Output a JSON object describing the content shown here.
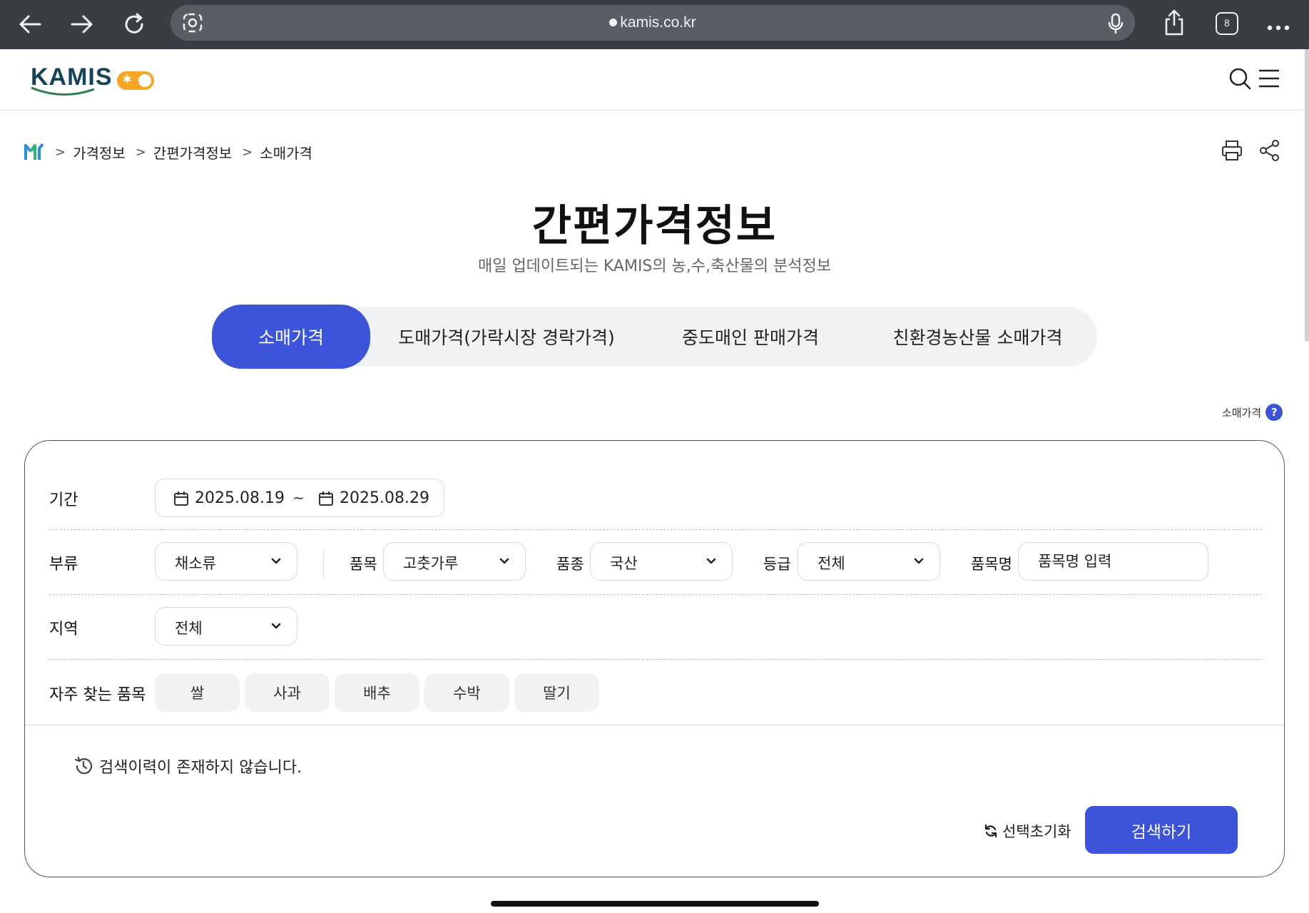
{
  "browser": {
    "url": "kamis.co.kr",
    "tab_count": "8"
  },
  "site": {
    "logo_text": "KAMIS"
  },
  "breadcrumb": {
    "items": [
      "가격정보",
      "간편가격정보",
      "소매가격"
    ],
    "separator": ">"
  },
  "page": {
    "title": "간편가격정보",
    "subtitle": "매일 업데이트되는 KAMIS의 농,수,축산물의 분석정보"
  },
  "tabs": [
    {
      "label": "소매가격",
      "active": true
    },
    {
      "label": "도매가격(가락시장 경락가격)",
      "active": false
    },
    {
      "label": "중도매인 판매가격",
      "active": false
    },
    {
      "label": "친환경농산물 소매가격",
      "active": false
    }
  ],
  "help": {
    "label": "소매가격",
    "icon": "?"
  },
  "search": {
    "period": {
      "label": "기간",
      "start": "2025.08.19",
      "tilde": "~",
      "end": "2025.08.29"
    },
    "category": {
      "label": "부류",
      "value": "채소류"
    },
    "item": {
      "label": "품목",
      "value": "고춧가루"
    },
    "variety": {
      "label": "품종",
      "value": "국산"
    },
    "grade": {
      "label": "등급",
      "value": "전체"
    },
    "item_name": {
      "label": "품목명",
      "placeholder": "품목명 입력"
    },
    "region": {
      "label": "지역",
      "value": "전체"
    },
    "frequent": {
      "label": "자주 찾는 품목",
      "chips": [
        "쌀",
        "사과",
        "배추",
        "수박",
        "딸기"
      ]
    },
    "history_text": "검색이력이 존재하지 않습니다.",
    "reset_label": "선택초기화",
    "submit_label": "검색하기"
  },
  "colors": {
    "accent": "#3b54d9",
    "chrome": "#3a3d42",
    "toggle": "#f5a623"
  }
}
